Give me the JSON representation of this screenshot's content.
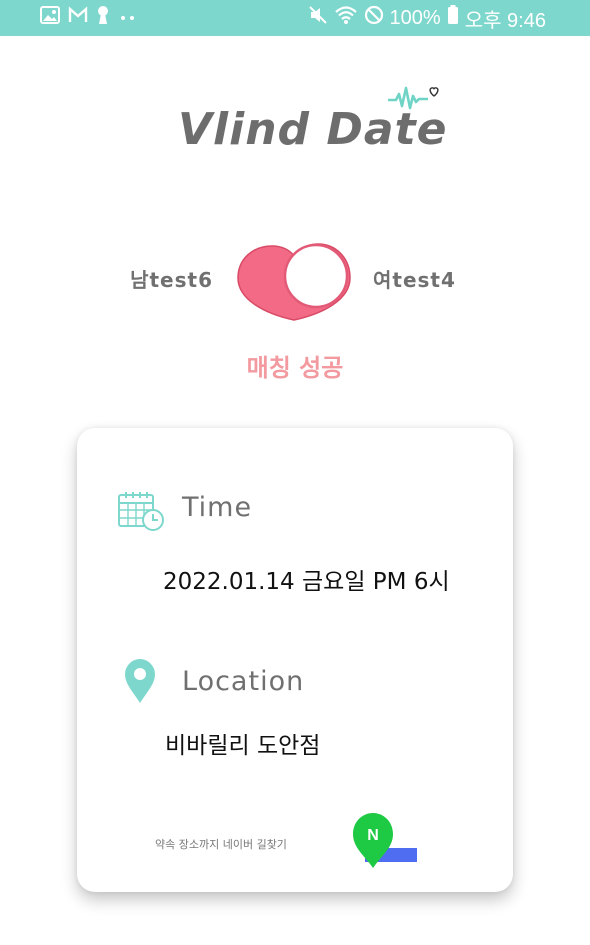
{
  "status_bar": {
    "battery": "100%",
    "time": "오후 9:46",
    "icons": [
      "gallery-icon",
      "mail-icon",
      "keyhole-icon",
      "more-dots-icon",
      "mute-icon",
      "wifi-icon",
      "blocked-icon",
      "battery-icon"
    ]
  },
  "app": {
    "logo_text": "Vlind Date",
    "accent_color": "#7dd7cc",
    "heart_color": "#f0627f"
  },
  "match": {
    "male_name": "남test6",
    "female_name": "여test4",
    "status": "매칭 성공"
  },
  "card": {
    "time_label": "Time",
    "time_value": "2022.01.14 금요일 PM 6시",
    "location_label": "Location",
    "location_value": "비바릴리 도안점",
    "navigation_link": "약속 장소까지 네이버 길찾기"
  }
}
